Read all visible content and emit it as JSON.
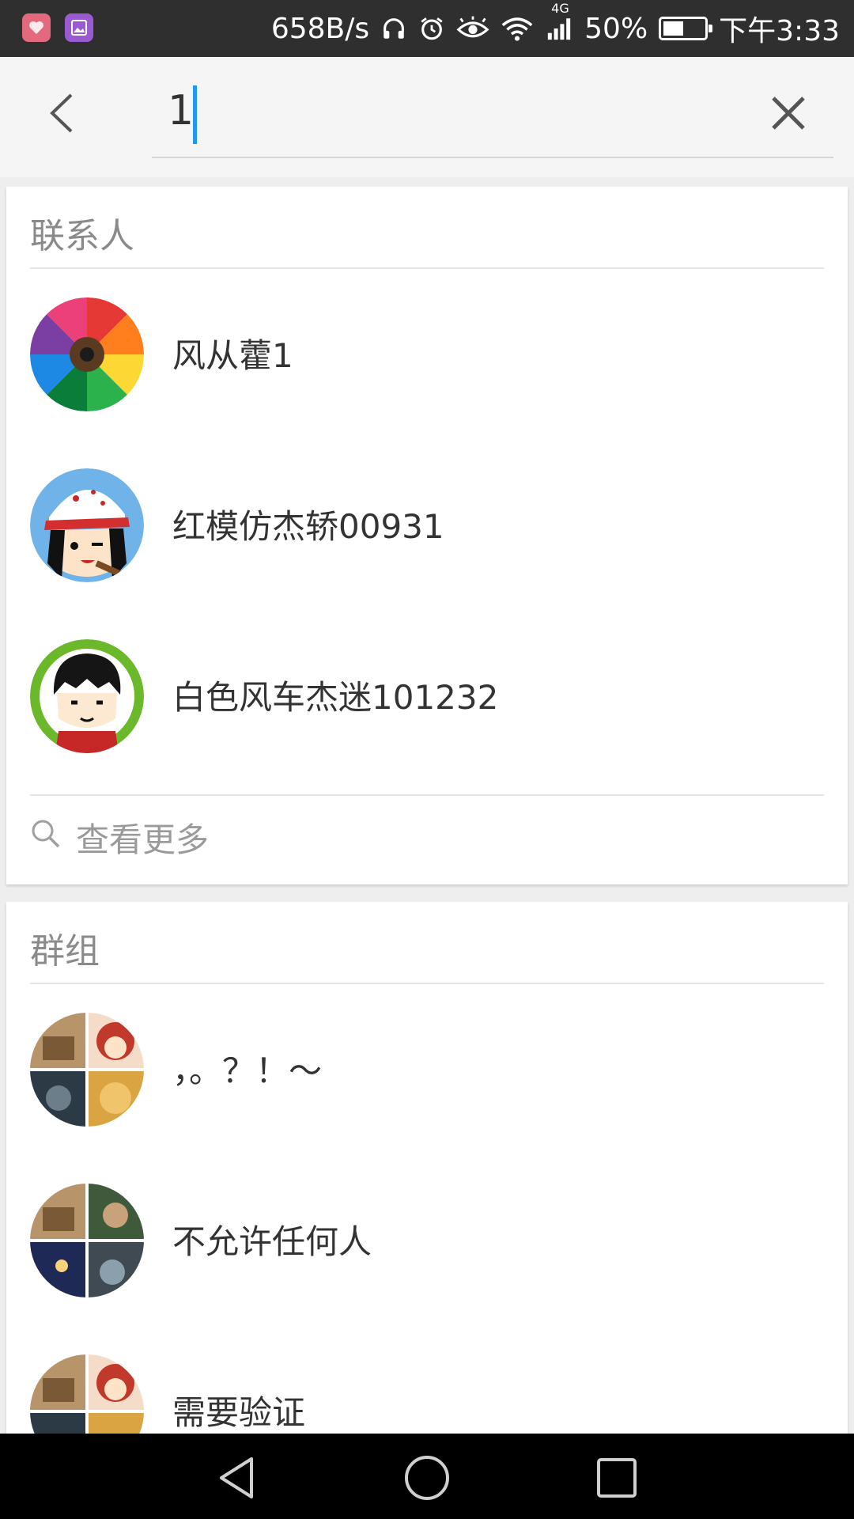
{
  "status_bar": {
    "net_speed": "658B/s",
    "signal_type": "4G",
    "battery": "50%",
    "battery_level": 0.5,
    "time": "下午3:33",
    "icons": [
      "health-app-icon",
      "gallery-app-icon",
      "headphones-icon",
      "alarm-icon",
      "eye-icon",
      "wifi-icon",
      "signal-icon",
      "battery-icon"
    ]
  },
  "search": {
    "value": "1",
    "icons": [
      "back-arrow-icon",
      "clear-x-icon"
    ]
  },
  "contacts_section": {
    "title": "联系人",
    "items": [
      {
        "name": "风从藿1",
        "avatar": "color-pencils"
      },
      {
        "name": "红模仿杰轿00931",
        "avatar": "cartoon-cap-girl"
      },
      {
        "name": "白色风车杰迷101232",
        "avatar": "cartoon-boy-green"
      }
    ],
    "more_label": "查看更多",
    "more_icon": "search-icon"
  },
  "groups_section": {
    "title": "群组",
    "items": [
      {
        "name": "，。？！～",
        "avatar": "group-mosaic"
      },
      {
        "name": "不允许任何人",
        "avatar": "group-mosaic"
      },
      {
        "name": "需要验证",
        "avatar": "group-mosaic"
      }
    ]
  },
  "nav_bar": {
    "icons": [
      "nav-back-icon",
      "nav-home-icon",
      "nav-recents-icon"
    ]
  },
  "colors": {
    "accent": "#2196f3",
    "status_bar": "#2f2f2f",
    "header_bg": "#f5f5f5",
    "page_bg": "#eeeeee",
    "section_title": "#8a8a8a"
  }
}
